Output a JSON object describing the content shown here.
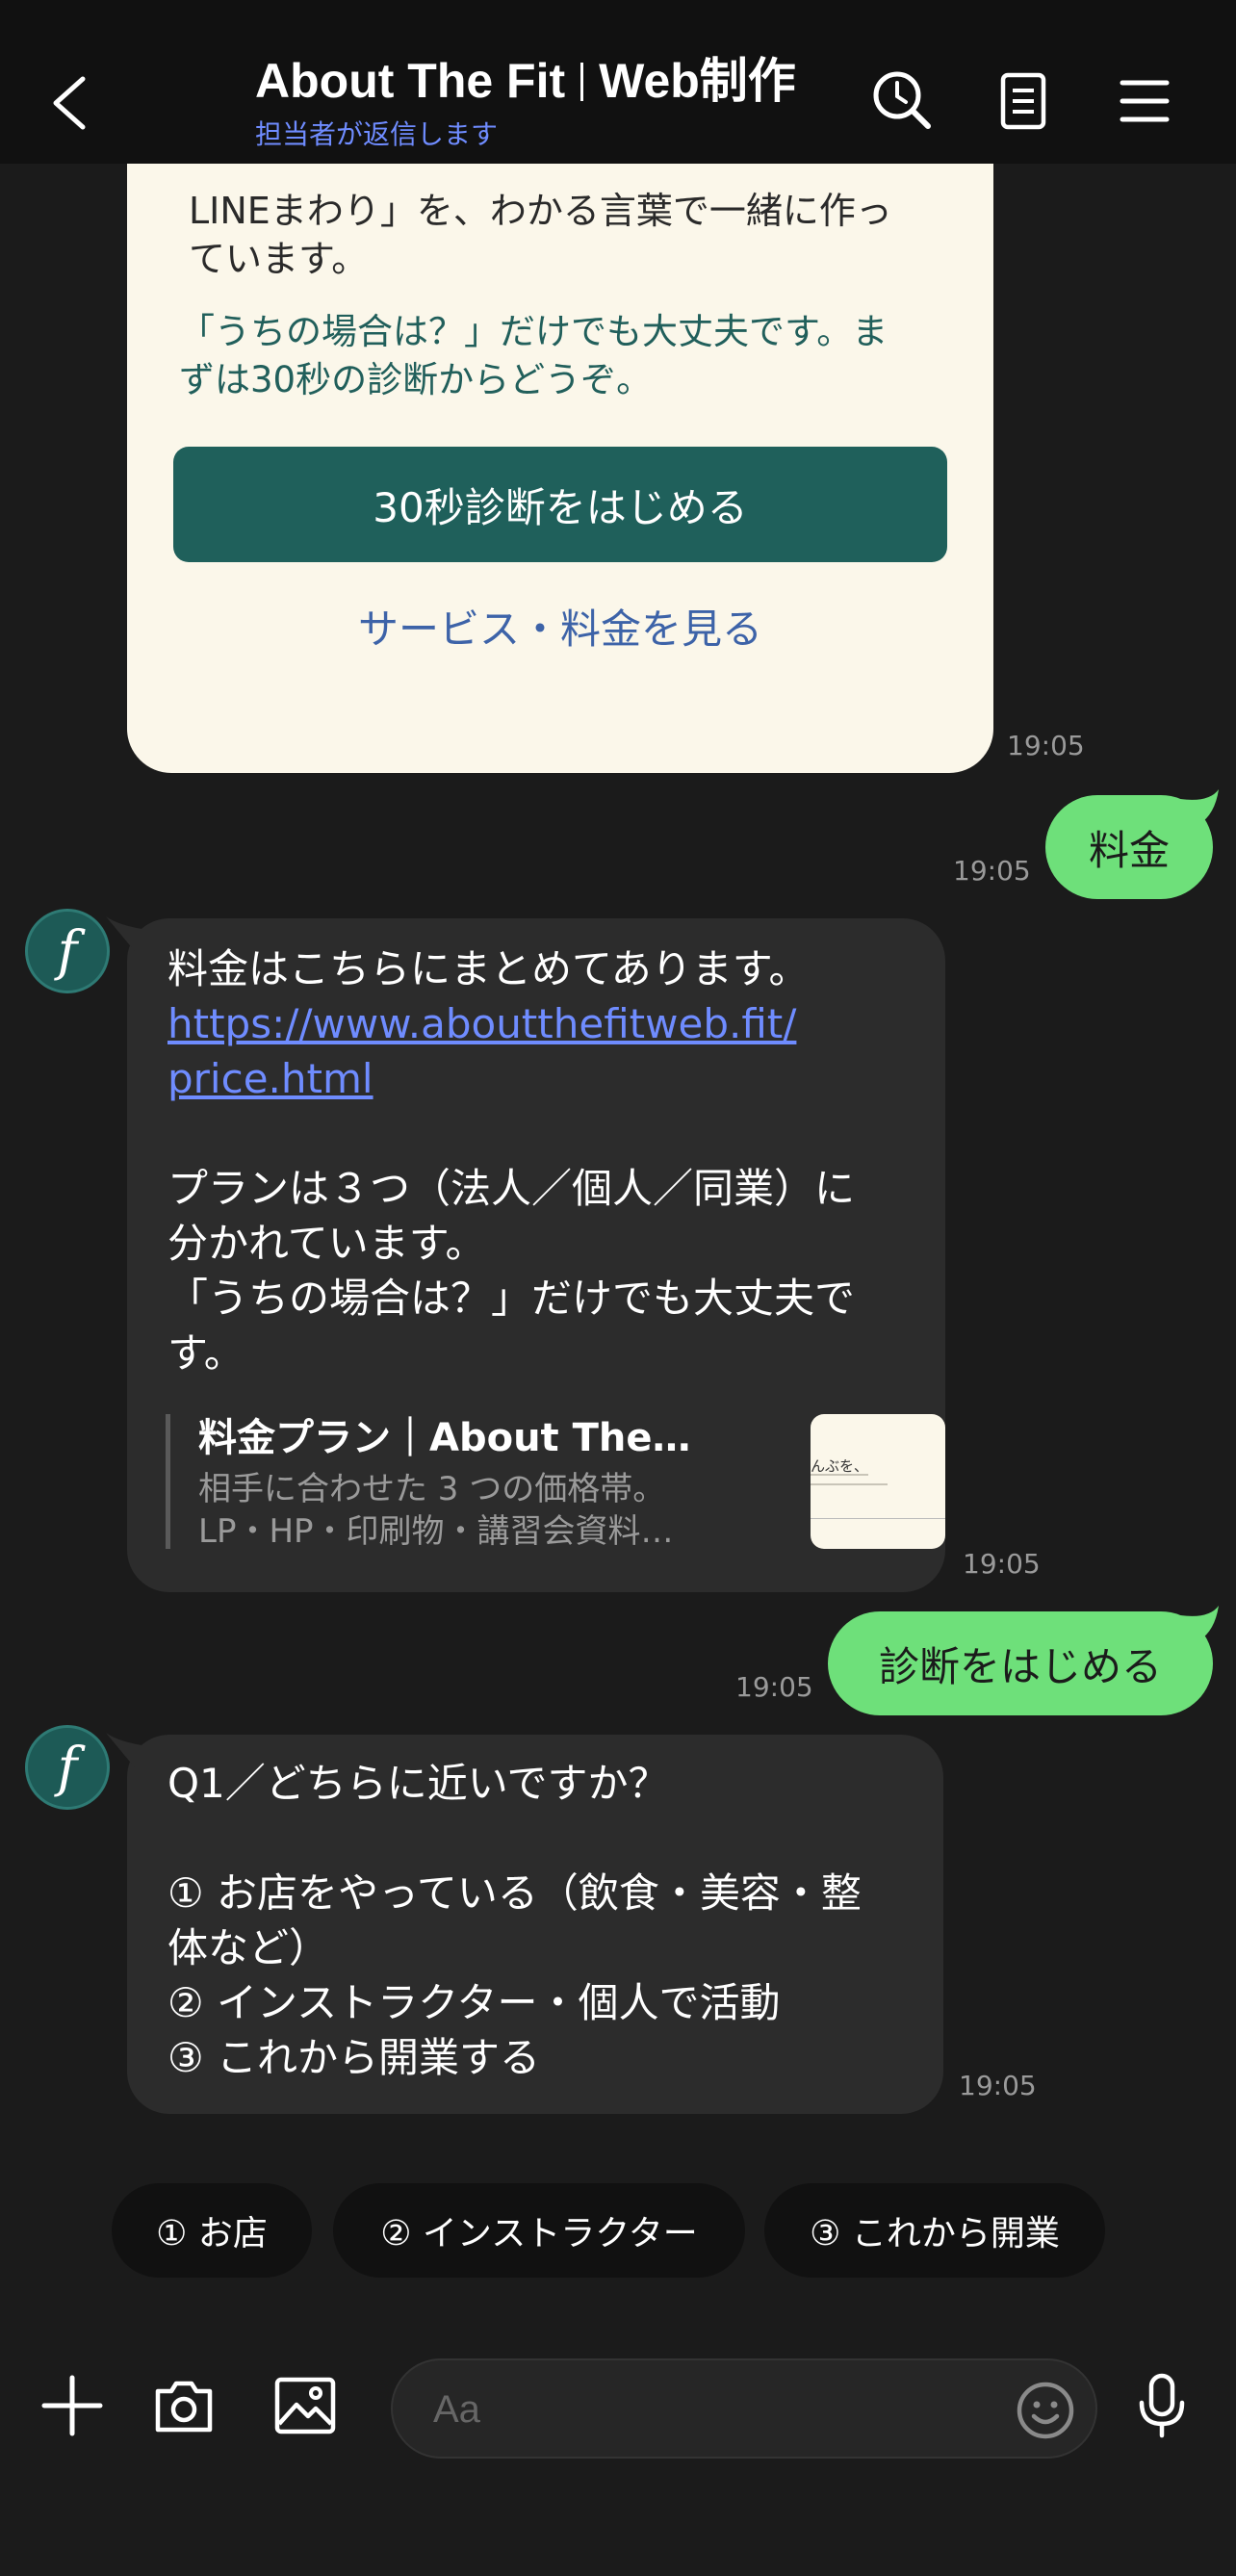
{
  "header": {
    "title_part1": "About The Fit",
    "title_part2": "Web制作",
    "subtitle": "担当者が返信します"
  },
  "card": {
    "text1_line1": "LINEまわり」を、わかる言葉で一緒に作っ",
    "text1_line2": "ています。",
    "text2_line1": "「うちの場合は？」だけでも大丈夫です。ま",
    "text2_line2": "ずは30秒の診断からどうぞ。",
    "primary_button": "30秒診断をはじめる",
    "link_button": "サービス・料金を見る",
    "time": "19:05"
  },
  "out_msg_1": {
    "text": "料金",
    "time": "19:05"
  },
  "in_msg_1": {
    "avatar_letter": "f",
    "line1": "料金はこちらにまとめてあります。",
    "link_line1": "https://www.aboutthefitweb.fit/",
    "link_line2": "price.html",
    "line3": "プランは３つ（法人／個人／同業）に",
    "line4": "分かれています。",
    "line5": "「うちの場合は？」だけでも大丈夫で",
    "line6": "す。",
    "preview_title": "料金プラン｜About The…",
    "preview_desc1": "相手に合わせた 3 つの価格帯。",
    "preview_desc2": "LP・HP・印刷物・講習会資料…",
    "thumb_text": "んぶを、",
    "time": "19:05"
  },
  "out_msg_2": {
    "text": "診断をはじめる",
    "time": "19:05"
  },
  "in_msg_2": {
    "avatar_letter": "f",
    "line1": "Q1／どちらに近いですか？",
    "line2": "① お店をやっている（飲食・美容・整",
    "line3": "体など）",
    "line4": "② インストラクター・個人で活動",
    "line5": "③ これから開業する",
    "time": "19:05"
  },
  "quick_replies": [
    "① お店",
    "② インストラクター",
    "③ これから開業"
  ],
  "input": {
    "placeholder": "Aa"
  },
  "colors": {
    "accent_green": "#6ee07a",
    "card_button": "#1f605b",
    "link_blue": "#6f8cff"
  },
  "icons": [
    "back-icon",
    "search-history-icon",
    "notes-icon",
    "menu-icon",
    "plus-icon",
    "camera-icon",
    "image-icon",
    "emoji-icon",
    "mic-icon"
  ]
}
